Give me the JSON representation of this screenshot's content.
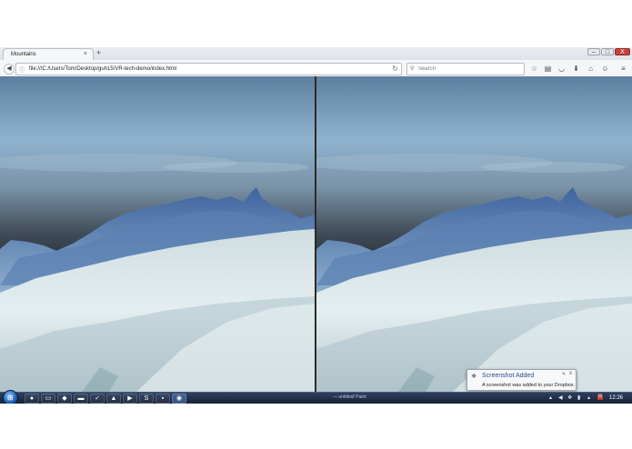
{
  "browser": {
    "tab_title": "Mountains",
    "tab_close": "×",
    "new_tab": "+",
    "url": "file:///C:/Users/Tom/Desktop/guh15/VR-tech-demo/index.html",
    "search_placeholder": "Search",
    "back_glyph": "◀",
    "reload_glyph": "↻",
    "window_controls": {
      "minimize": "–",
      "maximize": "□",
      "close": "X"
    }
  },
  "notification": {
    "title": "Screenshot Added",
    "message": "A screenshot was added to your Dropbox.",
    "close_glyph": "x",
    "pin_glyph": "✎"
  },
  "taskbar": {
    "window_label": "— untitled/ Paint",
    "clock": "12:26",
    "tray_badge": "R"
  },
  "colors": {
    "sky_top": "#5a7a98",
    "sky_horizon": "#2a2e34",
    "snow": "#d8e6ea",
    "rock_blue": "#4f74a8",
    "taskbar": "#1c2b47"
  }
}
